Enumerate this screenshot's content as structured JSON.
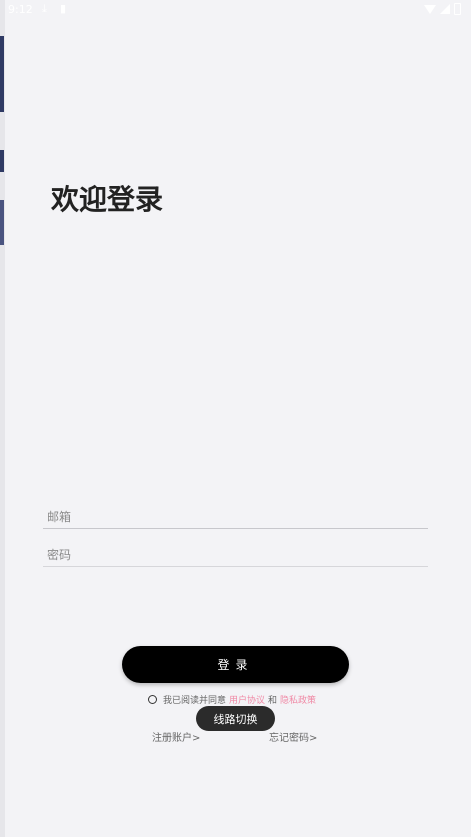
{
  "status_bar": {
    "time": "9:12",
    "download_icon": "download-icon",
    "sd_icon": "sd-card-icon",
    "wifi_icon": "wifi-icon",
    "signal_icon": "signal-icon",
    "battery_icon": "battery-icon"
  },
  "title": "欢迎登录",
  "form": {
    "email_placeholder": "邮箱",
    "password_placeholder": "密码"
  },
  "login_button": "登录",
  "agreement": {
    "prefix": "我已阅读并同意",
    "user_agreement": "用户协议",
    "and": "和",
    "privacy_policy": "隐私政策",
    "link_color": "#f08aa6"
  },
  "toast": "线路切换",
  "links": {
    "register": "注册账户>",
    "forgot": "忘记密码>"
  },
  "colors": {
    "background": "#f3f3f6",
    "primary_button": "#000000"
  }
}
